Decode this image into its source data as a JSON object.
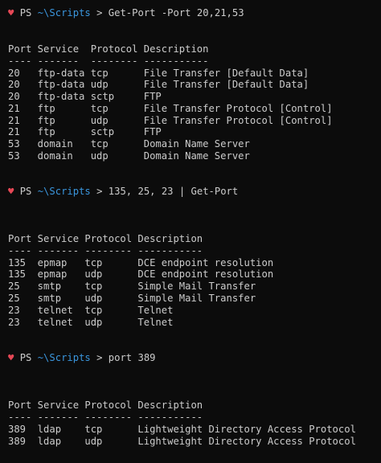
{
  "blocks": [
    {
      "prompt": {
        "heart": "♥",
        "ps": "PS",
        "path": "~\\Scripts",
        "gt": ">",
        "command": "Get-Port -Port 20,21,53"
      },
      "header": "Port Service  Protocol Description",
      "divider": "---- -------  -------- -----------",
      "rows": [
        "20   ftp-data tcp      File Transfer [Default Data]",
        "20   ftp-data udp      File Transfer [Default Data]",
        "20   ftp-data sctp     FTP",
        "21   ftp      tcp      File Transfer Protocol [Control]",
        "21   ftp      udp      File Transfer Protocol [Control]",
        "21   ftp      sctp     FTP",
        "53   domain   tcp      Domain Name Server",
        "53   domain   udp      Domain Name Server"
      ]
    },
    {
      "prompt": {
        "heart": "♥",
        "ps": "PS",
        "path": "~\\Scripts",
        "gt": ">",
        "command": "135, 25, 23 | Get-Port"
      },
      "header": "Port Service Protocol Description",
      "divider": "---- ------- -------- -----------",
      "rows": [
        "135  epmap   tcp      DCE endpoint resolution",
        "135  epmap   udp      DCE endpoint resolution",
        "25   smtp    tcp      Simple Mail Transfer",
        "25   smtp    udp      Simple Mail Transfer",
        "23   telnet  tcp      Telnet",
        "23   telnet  udp      Telnet"
      ]
    },
    {
      "prompt": {
        "heart": "♥",
        "ps": "PS",
        "path": "~\\Scripts",
        "gt": ">",
        "command": "port 389"
      },
      "header": "Port Service Protocol Description",
      "divider": "---- ------- -------- -----------",
      "rows": [
        "389  ldap    tcp      Lightweight Directory Access Protocol",
        "389  ldap    udp      Lightweight Directory Access Protocol"
      ]
    }
  ],
  "colors": {
    "background": "#0c0c0c",
    "text": "#cccccc",
    "heart": "#e74856",
    "path": "#3a96dd"
  }
}
